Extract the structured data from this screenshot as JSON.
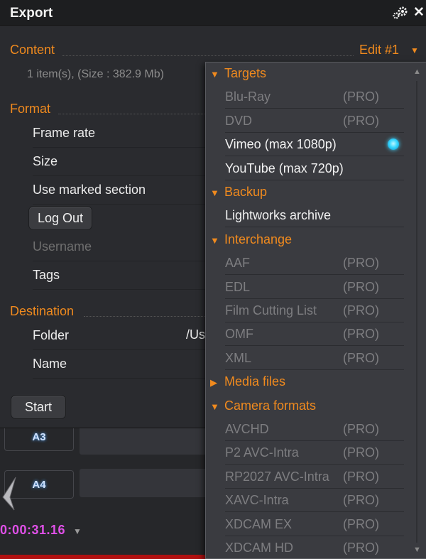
{
  "window": {
    "title": "Export"
  },
  "content": {
    "heading": "Content",
    "meta": "1 item(s), (Size : 382.9 Mb)",
    "edit_selector": "Edit #1"
  },
  "format": {
    "heading": "Format",
    "rows": [
      {
        "label": "Frame rate"
      },
      {
        "label": "Size"
      },
      {
        "label": "Use marked section"
      }
    ],
    "logout_label": "Log Out",
    "username_placeholder": "Username",
    "tags_label": "Tags"
  },
  "destination": {
    "heading": "Destination",
    "folder_label": "Folder",
    "folder_value": "/Us",
    "name_label": "Name"
  },
  "start_label": "Start",
  "timeline": {
    "tracks": [
      "A3",
      "A4"
    ],
    "timecode": "0:00:31.16"
  },
  "dropdown": {
    "selected": "Vimeo (max 1080p)",
    "groups": [
      {
        "label": "Targets",
        "expanded": true,
        "items": [
          {
            "label": "Blu-Ray",
            "tag": "(PRO)"
          },
          {
            "label": "DVD",
            "tag": "(PRO)"
          },
          {
            "label": "Vimeo (max 1080p)",
            "tag": ""
          },
          {
            "label": "YouTube (max 720p)",
            "tag": ""
          }
        ]
      },
      {
        "label": "Backup",
        "expanded": true,
        "items": [
          {
            "label": "Lightworks archive",
            "tag": ""
          }
        ]
      },
      {
        "label": "Interchange",
        "expanded": true,
        "items": [
          {
            "label": "AAF",
            "tag": "(PRO)"
          },
          {
            "label": "EDL",
            "tag": "(PRO)"
          },
          {
            "label": "Film Cutting List",
            "tag": "(PRO)"
          },
          {
            "label": "OMF",
            "tag": "(PRO)"
          },
          {
            "label": "XML",
            "tag": "(PRO)"
          }
        ]
      },
      {
        "label": "Media files",
        "expanded": false,
        "items": []
      },
      {
        "label": "Camera formats",
        "expanded": true,
        "items": [
          {
            "label": "AVCHD",
            "tag": "(PRO)"
          },
          {
            "label": "P2 AVC-Intra",
            "tag": "(PRO)"
          },
          {
            "label": "RP2027 AVC-Intra",
            "tag": "(PRO)"
          },
          {
            "label": "XAVC-Intra",
            "tag": "(PRO)"
          },
          {
            "label": "XDCAM EX",
            "tag": "(PRO)"
          },
          {
            "label": "XDCAM HD",
            "tag": "(PRO)"
          }
        ]
      }
    ]
  },
  "colors": {
    "accent": "#f08a1e",
    "selection": "#38d7ff",
    "timecode": "#e050e8",
    "record_bar": "#b01010"
  },
  "icons": {
    "gear": "gear-icon",
    "close": "close-icon",
    "expanded": "triangle-down-icon",
    "collapsed": "triangle-right-icon"
  }
}
